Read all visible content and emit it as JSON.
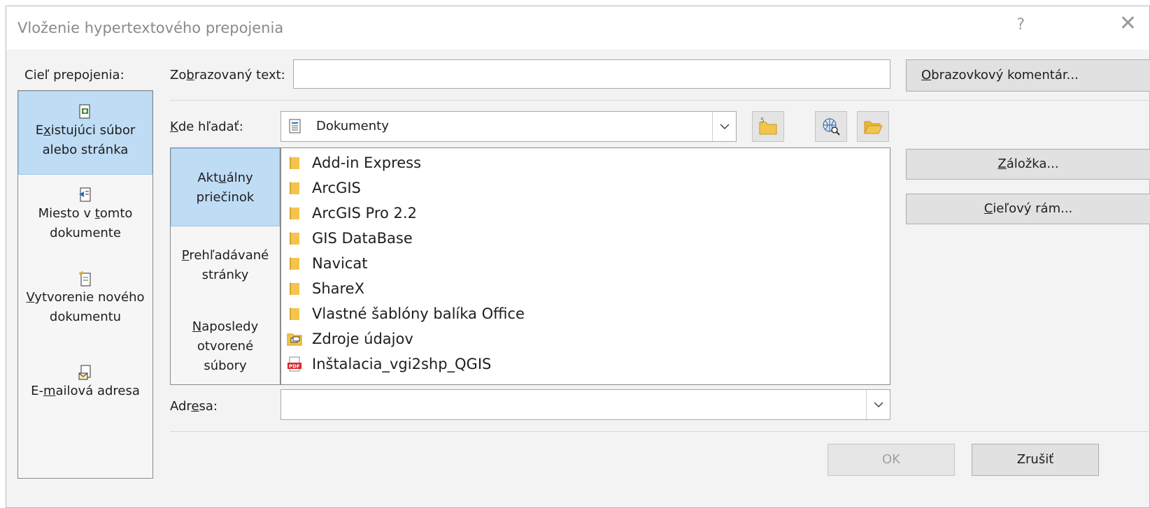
{
  "window": {
    "title": "Vloženie hypertextového prepojenia",
    "help_glyph": "?",
    "close_glyph": "✕"
  },
  "labels": {
    "link_target": "Cieľ prepojenia:",
    "display_text_pre": "Zo",
    "display_text_u": "b",
    "display_text_post": "razovaný text:",
    "look_in_u": "K",
    "look_in_post": "de hľadať:",
    "address_pre": "Adr",
    "address_u": "e",
    "address_post": "sa:"
  },
  "fields": {
    "display_text": "",
    "address": "",
    "look_in_value": "Dokumenty"
  },
  "left_nav": [
    {
      "line1_pre": "E",
      "line1_u": "x",
      "line1_post": "istujúci súbor",
      "line2": "alebo stránka",
      "icon": "existing-file-icon"
    },
    {
      "line1_pre": "Miesto v ",
      "line1_u": "t",
      "line1_post": "omto",
      "line2": "dokumente",
      "icon": "place-in-document-icon"
    },
    {
      "line1_pre": "",
      "line1_u": "V",
      "line1_post": "ytvorenie nového",
      "line2": "dokumentu",
      "icon": "new-document-icon"
    },
    {
      "line1_pre": "E-",
      "line1_u": "m",
      "line1_post": "ailová adresa",
      "line2": "",
      "icon": "email-address-icon"
    }
  ],
  "side_tabs": [
    {
      "l1_pre": "Akt",
      "l1_u": "u",
      "l1_post": "álny",
      "l2": "priečinok",
      "l3": ""
    },
    {
      "l1_pre": "",
      "l1_u": "P",
      "l1_post": "rehľadávané",
      "l2": "stránky",
      "l3": ""
    },
    {
      "l1_pre": "",
      "l1_u": "N",
      "l1_post": "aposledy",
      "l2": "otvorené",
      "l3": "súbory"
    }
  ],
  "files": [
    {
      "name": "Add-in Express",
      "icon": "folder-icon"
    },
    {
      "name": "ArcGIS",
      "icon": "folder-icon"
    },
    {
      "name": "ArcGIS Pro 2.2",
      "icon": "folder-icon"
    },
    {
      "name": "GIS DataBase",
      "icon": "folder-icon"
    },
    {
      "name": "Navicat",
      "icon": "folder-icon"
    },
    {
      "name": "ShareX",
      "icon": "folder-icon"
    },
    {
      "name": "Vlastné šablóny balíka Office",
      "icon": "folder-icon"
    },
    {
      "name": "Zdroje údajov",
      "icon": "data-sources-folder-icon"
    },
    {
      "name": "Inštalacia_vgi2shp_QGIS",
      "icon": "pdf-icon"
    }
  ],
  "buttons": {
    "screentip_u": "O",
    "screentip_post": "brazovkový komentár...",
    "bookmark_u": "Z",
    "bookmark_post": "áložka...",
    "target_frame_u": "C",
    "target_frame_post": "ieľový rám...",
    "ok": "OK",
    "cancel": "Zrušiť"
  },
  "colors": {
    "selected": "#bfdcf5",
    "folder": "#f3c54f",
    "pdf": "#d9262c"
  }
}
